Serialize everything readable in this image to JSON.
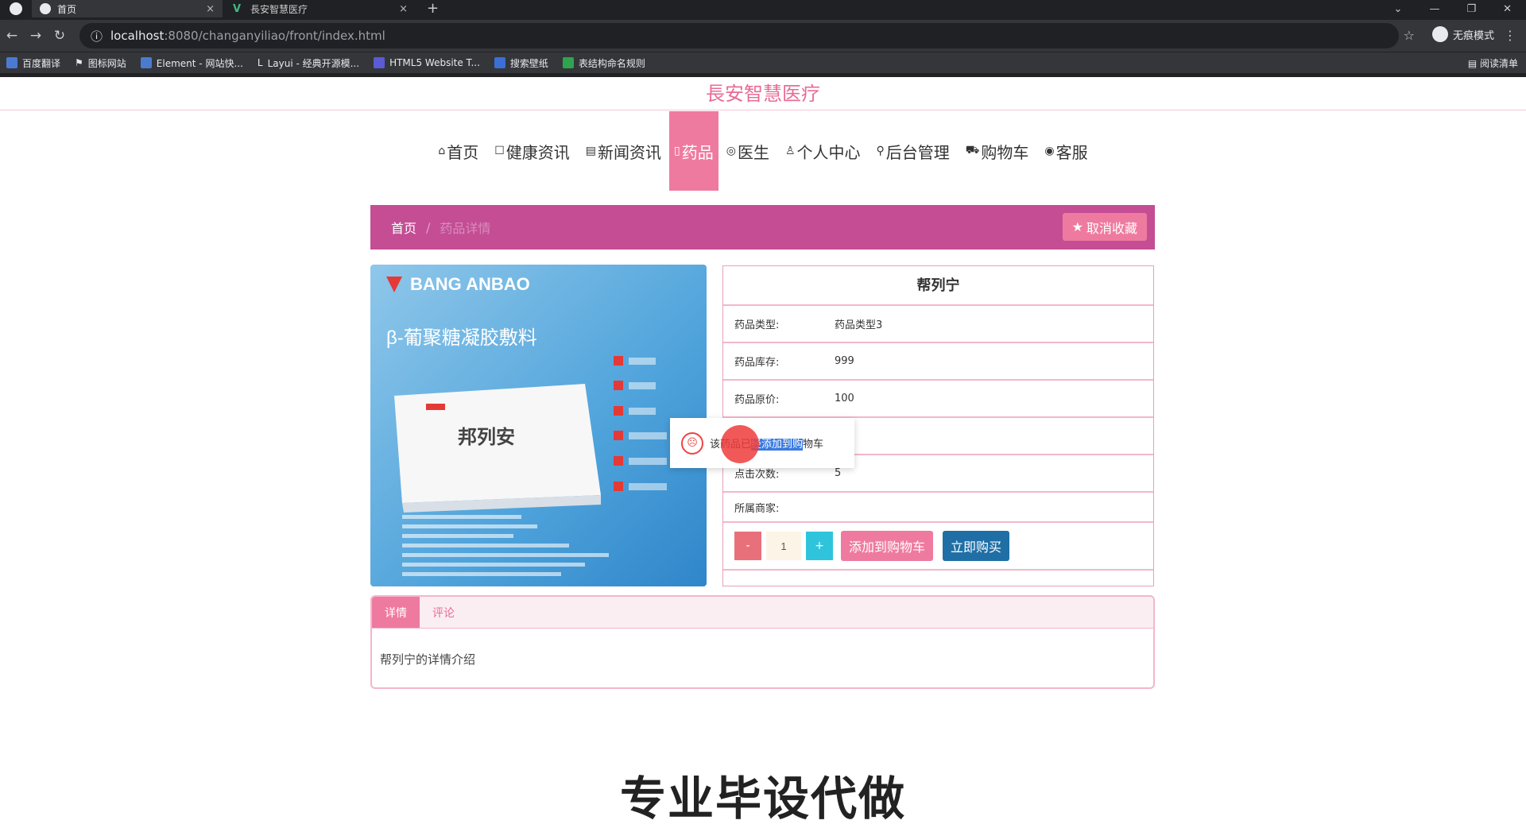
{
  "browser": {
    "tabs": [
      {
        "title": "首页",
        "active": true
      },
      {
        "title": "長安智慧医疗",
        "active": false
      }
    ],
    "new_tab": "+",
    "url_host": "localhost",
    "url_path": ":8080/changanyiliao/front/index.html",
    "profile_label": "无痕模式",
    "bookmarks": [
      "百度翻译",
      "图标网站",
      "Element - 网站快...",
      "Layui - 经典开源模...",
      "HTML5 Website T...",
      "搜索壁纸",
      "表结构命名规则"
    ],
    "reading_list": "阅读清单",
    "close_x": "×",
    "window_controls": [
      "⌄",
      "—",
      "❐",
      "✕"
    ]
  },
  "site": {
    "title": "長安智慧医疗",
    "nav": [
      {
        "icon": "⌂",
        "label": "首页"
      },
      {
        "icon": "☐",
        "label": "健康资讯"
      },
      {
        "icon": "▤",
        "label": "新闻资讯"
      },
      {
        "icon": "▯",
        "label": "药品"
      },
      {
        "icon": "◎",
        "label": "医生"
      },
      {
        "icon": "♙",
        "label": "个人中心"
      },
      {
        "icon": "⚲",
        "label": "后台管理"
      },
      {
        "icon": "⛟",
        "label": "购物车"
      },
      {
        "icon": "◉",
        "label": "客服"
      }
    ],
    "active_nav": "药品"
  },
  "breadcrumb": {
    "home": "首页",
    "sep": "/",
    "current": "药品详情",
    "unfav_button": "取消收藏",
    "unfav_icon": "★"
  },
  "product": {
    "name": "帮列宁",
    "image_brand": "BANG ANBAO",
    "image_product_title": "β-葡聚糖凝胶敷料",
    "image_box_name": "邦列安",
    "rows": [
      {
        "label": "药品类型:",
        "value": "药品类型3"
      },
      {
        "label": "药品库存:",
        "value": "999"
      },
      {
        "label": "药品原价:",
        "value": "100"
      },
      {
        "label": "",
        "value": ""
      },
      {
        "label": "点击次数:",
        "value": "5"
      },
      {
        "label": "所属商家:",
        "value": ""
      }
    ],
    "qty_minus": "-",
    "qty_value": "1",
    "qty_plus": "+",
    "add_cart": "添加到购物车",
    "buy_now": "立即购买"
  },
  "toast": {
    "prefix": "该药品已",
    "highlight": "经添加到购",
    "suffix": "物车",
    "icon": "☹"
  },
  "detail_tabs": {
    "tabs": [
      "详情",
      "评论"
    ],
    "active": "详情",
    "content": "帮列宁的详情介绍"
  },
  "watermark": "专业毕设代做",
  "colors": {
    "brand_pink": "#ef7aa0",
    "breadcrumb_purple": "#c44d94",
    "buy_blue": "#1f6fa6",
    "plus_cyan": "#2fc4dc"
  }
}
